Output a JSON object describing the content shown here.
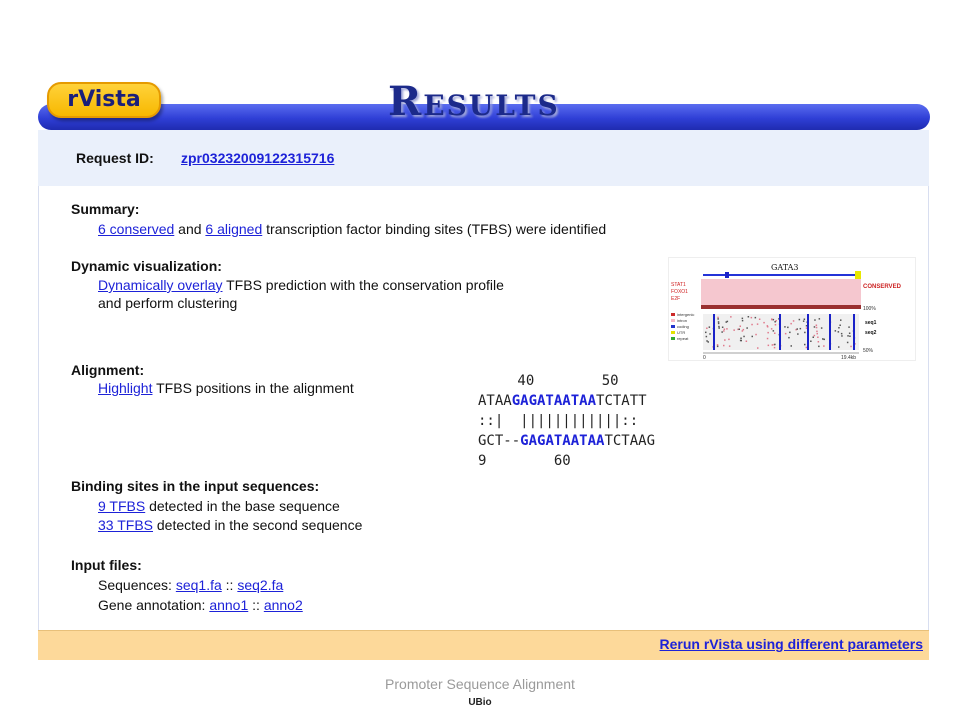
{
  "header": {
    "logo": "rVista",
    "title": "Results"
  },
  "request": {
    "label": "Request ID:",
    "id": "zpr03232009122315716"
  },
  "summary": {
    "heading": "Summary:",
    "conserved_link": "6 conserved",
    "and_text": "and",
    "aligned_link": "6 aligned",
    "rest_text": "transcription factor binding sites (TFBS) were identified"
  },
  "dynamic": {
    "heading": "Dynamic visualization:",
    "link": "Dynamically overlay",
    "text1": "TFBS prediction with the conservation profile",
    "text2": "and perform clustering"
  },
  "alignment": {
    "heading": "Alignment:",
    "link": "Highlight",
    "text": "TFBS positions in the alignment",
    "snippet": {
      "top_ruler": " 40        50",
      "seq1_pre": "ATAA",
      "seq1_hl": "GAGATAATAA",
      "seq1_post": "TCTATT",
      "match": "::|  ||||||||||||::",
      "seq2_pre": "GCT--",
      "seq2_hl": "GAGATAATAA",
      "seq2_post": "TCTAAG",
      "bottom_ruler": "9        60"
    }
  },
  "binding": {
    "heading": "Binding sites in the input sequences:",
    "base_link": "9 TFBS",
    "base_text": "detected in the base sequence",
    "second_link": "33 TFBS",
    "second_text": "detected in the second sequence"
  },
  "inputs": {
    "heading": "Input files:",
    "seq_label": "Sequences:",
    "seq1": "seq1.fa",
    "sep1": "::",
    "seq2": "seq2.fa",
    "anno_label": "Gene annotation:",
    "anno1": "anno1",
    "sep2": "::",
    "anno2": "anno2"
  },
  "thumbnail": {
    "gene": "GATA3",
    "tfs": [
      "STAT1",
      "FOXO1",
      "E2F"
    ],
    "conserved_label": "CONSERVED",
    "pct_top": "100%",
    "pct_bottom": "50%",
    "legend": [
      "intergenic",
      "intron",
      "coding",
      "UTR",
      "repeat"
    ],
    "seq_labels": [
      "seq1",
      "seq2"
    ],
    "axis_start": "0",
    "axis_end": "19.4kb"
  },
  "footer": {
    "rerun": "Rerun rVista using different parameters"
  },
  "caption": "Promoter Sequence Alignment",
  "credit": "UBio",
  "colors": {
    "header_blue": "#2f3fd6",
    "logo_yellow": "#f7b800",
    "link_blue": "#1d22d8",
    "footer_orange": "#fdd99a",
    "panel_blue": "#eaf0fb"
  }
}
